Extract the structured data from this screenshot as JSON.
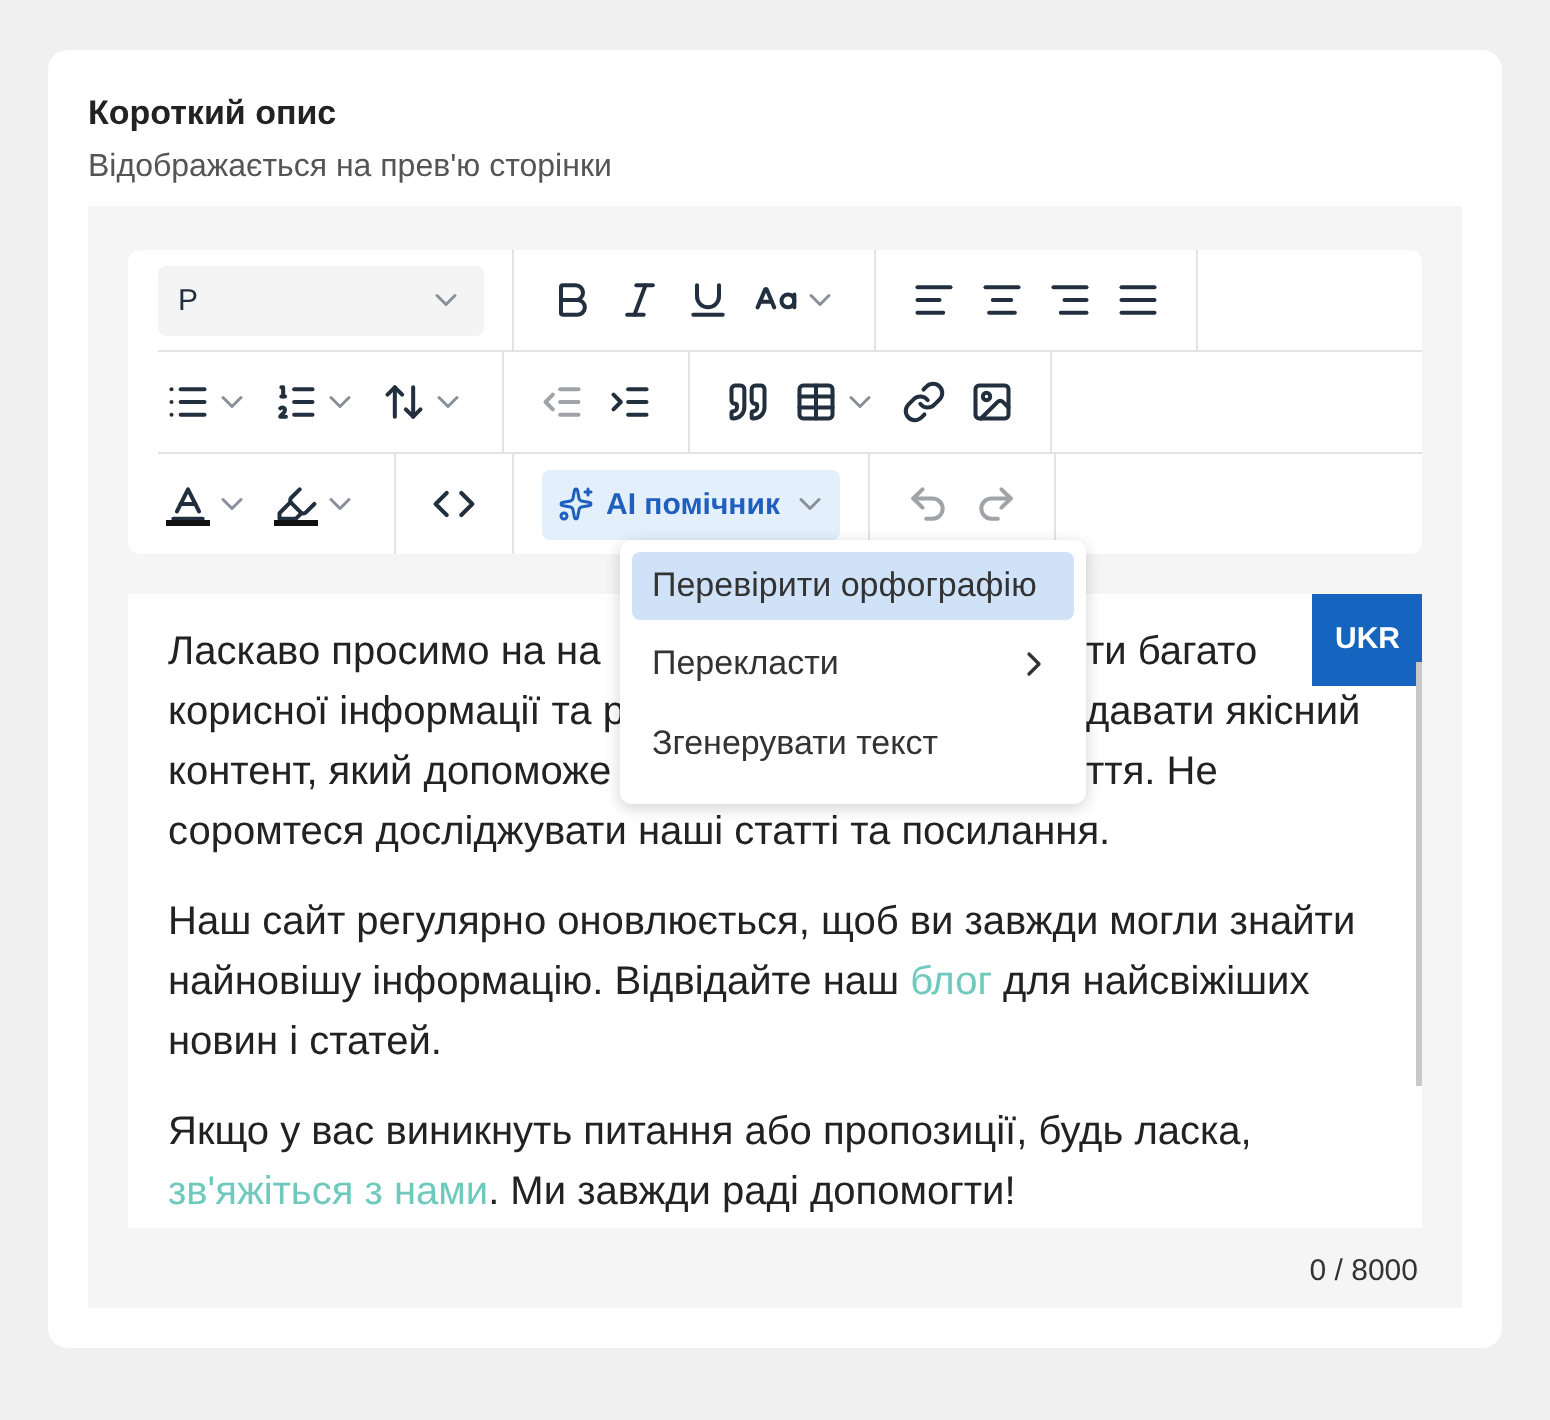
{
  "section": {
    "title": "Короткий опис",
    "subtitle": "Відображається на прев'ю сторінки"
  },
  "toolbar": {
    "rows": [
      [
        {
          "tools": [
            {
              "kind": "select",
              "value": "P"
            }
          ]
        },
        {
          "tools": [
            {
              "kind": "bold",
              "disabled": false
            },
            {
              "kind": "italic",
              "disabled": false
            },
            {
              "kind": "underline",
              "disabled": false
            },
            {
              "kind": "fontcase",
              "disabled": false,
              "dropdown": true
            }
          ]
        },
        {
          "tools": [
            {
              "kind": "alignleft",
              "disabled": false
            },
            {
              "kind": "aligncenter",
              "disabled": false
            },
            {
              "kind": "alignright",
              "disabled": false
            },
            {
              "kind": "justify",
              "disabled": false
            }
          ]
        }
      ],
      [
        {
          "tools": [
            {
              "kind": "bullets",
              "disabled": false,
              "dropdown": true
            },
            {
              "kind": "numbers",
              "disabled": false,
              "dropdown": true
            },
            {
              "kind": "lineheight",
              "disabled": false,
              "dropdown": true
            }
          ]
        },
        {
          "tools": [
            {
              "kind": "outdent",
              "disabled": true
            },
            {
              "kind": "indent",
              "disabled": false
            }
          ]
        },
        {
          "tools": [
            {
              "kind": "quote",
              "disabled": false
            },
            {
              "kind": "table",
              "disabled": false,
              "dropdown": true
            },
            {
              "kind": "link",
              "disabled": false
            },
            {
              "kind": "image",
              "disabled": false
            }
          ]
        }
      ],
      [
        {
          "tools": [
            {
              "kind": "textcolor",
              "disabled": false,
              "dropdown": true
            },
            {
              "kind": "highlight",
              "disabled": false,
              "dropdown": true
            }
          ]
        },
        {
          "tools": [
            {
              "kind": "code",
              "disabled": false
            }
          ]
        },
        {
          "tools": [
            {
              "kind": "ai",
              "label": "AI помічник",
              "open": true
            }
          ]
        },
        {
          "tools": [
            {
              "kind": "undo",
              "disabled": true
            },
            {
              "kind": "redo",
              "disabled": true
            }
          ]
        }
      ]
    ]
  },
  "menu": {
    "items": [
      {
        "label": "Перевірити орфографію",
        "selected": true
      },
      {
        "label": "Перекласти",
        "selected": false,
        "submenu": true
      },
      {
        "label": "Згенерувати текст",
        "selected": false
      }
    ]
  },
  "editor": {
    "language_badge": "UKR",
    "first_paragraph_lines": [
      {
        "left": "Ласкаво просимо на на",
        "right": "ти багато"
      },
      {
        "left": "корисної інформації та р",
        "right": "давати якісний"
      },
      {
        "left": "контент, який допоможе",
        "right": "ття. Не"
      },
      {
        "left": "соромтеся досліджувати наші статті та посилання."
      }
    ],
    "paragraphs": [
      [
        {
          "text": "Наш сайт регулярно оновлюється, щоб ви завжди могли знайти найновішу інформацію. Відвідайте наш "
        },
        {
          "text": "блог",
          "link": true
        },
        {
          "text": " для найсвіжіших новин і статей."
        }
      ],
      [
        {
          "text": "Якщо у вас виникнуть питання або пропозиції, будь ласка, "
        },
        {
          "text": "зв'яжіться з нами",
          "link": true
        },
        {
          "text": ". Ми завжди раді допомогти!"
        }
      ]
    ]
  },
  "counter": "0 / 8000"
}
